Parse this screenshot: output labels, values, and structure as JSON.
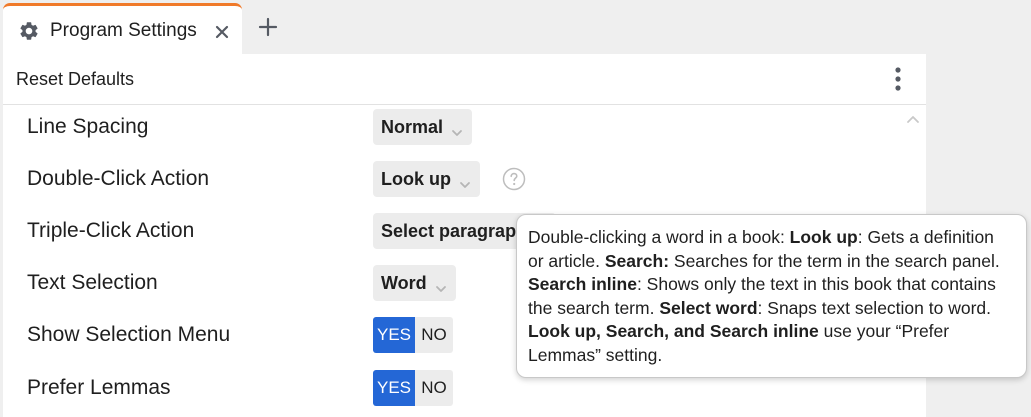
{
  "tab": {
    "label": "Program Settings",
    "icon": "gear-icon",
    "close_icon": "close-icon",
    "accent_color": "#f07a2a"
  },
  "new_tab_icon": "plus-icon",
  "toolbar": {
    "reset_label": "Reset Defaults",
    "menu_icon": "kebab-menu-icon"
  },
  "settings": {
    "line_spacing": {
      "label": "Line Spacing",
      "value": "Normal"
    },
    "double_click": {
      "label": "Double-Click Action",
      "value": "Look up",
      "help_icon": "help-icon"
    },
    "triple_click": {
      "label": "Triple-Click Action",
      "value": "Select paragraph"
    },
    "text_selection": {
      "label": "Text Selection",
      "value": "Word"
    },
    "show_selection_menu": {
      "label": "Show Selection Menu",
      "yes": "YES",
      "no": "NO",
      "selected": "YES"
    },
    "prefer_lemmas": {
      "label": "Prefer Lemmas",
      "yes": "YES",
      "no": "NO",
      "selected": "YES"
    }
  },
  "toggle_accent_color": "#2467d6",
  "tooltip": {
    "l1_a": "Double-clicking a word in a book: ",
    "l1_b": "Look up",
    "l1_c": ": Gets a definition",
    "l2_a": "or article. ",
    "l2_b": "Search:",
    "l2_c": " Searches for the term in the search panel.",
    "l3_a": "Search inline",
    "l3_b": ": Shows only the text in this book that contains",
    "l4_a": "the search term. ",
    "l4_b": "Select word",
    "l4_c": ": Snaps text selection to word.",
    "l5_a": "Look up, Search, and Search inline",
    "l5_b": " use your “Prefer",
    "l6_a": "Lemmas” setting."
  }
}
